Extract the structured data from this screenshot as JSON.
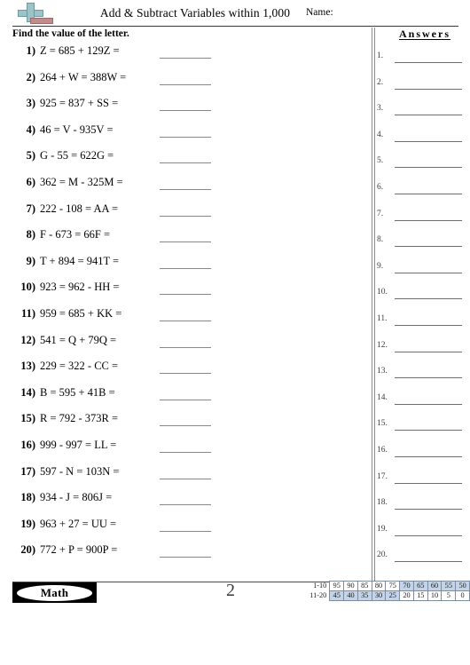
{
  "header": {
    "logo_name": "plus-minus-logo",
    "title": "Add & Subtract Variables within 1,000",
    "name_label": "Name:",
    "colors": {
      "plus": "#9cc3c8",
      "minus": "#c08b8b"
    }
  },
  "instruction": "Find the value of the letter.",
  "answers_heading": "Answers",
  "problems": [
    {
      "num": "1)",
      "text": "Z = 685 + 129Z ="
    },
    {
      "num": "2)",
      "text": "264 + W = 388W ="
    },
    {
      "num": "3)",
      "text": "925 = 837 + SS ="
    },
    {
      "num": "4)",
      "text": "46 = V - 935V ="
    },
    {
      "num": "5)",
      "text": "G - 55 = 622G ="
    },
    {
      "num": "6)",
      "text": "362 = M - 325M ="
    },
    {
      "num": "7)",
      "text": "222 - 108 = AA ="
    },
    {
      "num": "8)",
      "text": "F - 673 = 66F ="
    },
    {
      "num": "9)",
      "text": "T + 894 = 941T ="
    },
    {
      "num": "10)",
      "text": "923 = 962 - HH ="
    },
    {
      "num": "11)",
      "text": "959 = 685 + KK ="
    },
    {
      "num": "12)",
      "text": "541 = Q + 79Q ="
    },
    {
      "num": "13)",
      "text": "229 = 322 - CC ="
    },
    {
      "num": "14)",
      "text": "B = 595 + 41B ="
    },
    {
      "num": "15)",
      "text": "R = 792 - 373R ="
    },
    {
      "num": "16)",
      "text": "999 - 997 = LL ="
    },
    {
      "num": "17)",
      "text": "597 - N = 103N ="
    },
    {
      "num": "18)",
      "text": "934 - J = 806J ="
    },
    {
      "num": "19)",
      "text": "963 + 27 = UU ="
    },
    {
      "num": "20)",
      "text": "772 + P = 900P ="
    }
  ],
  "answer_numbers": [
    "1.",
    "2.",
    "3.",
    "4.",
    "5.",
    "6.",
    "7.",
    "8.",
    "9.",
    "10.",
    "11.",
    "12.",
    "13.",
    "14.",
    "15.",
    "16.",
    "17.",
    "18.",
    "19.",
    "20."
  ],
  "footer": {
    "badge_label": "Math",
    "page_number": "2"
  },
  "grading_scale": {
    "row1_label": "1-10",
    "row2_label": "11-20",
    "row1_values": [
      "95",
      "90",
      "85",
      "80",
      "75",
      "70",
      "65",
      "60",
      "55",
      "50"
    ],
    "row1_shaded": [
      false,
      false,
      false,
      false,
      false,
      true,
      true,
      true,
      true,
      true
    ],
    "row2_values": [
      "45",
      "40",
      "35",
      "30",
      "25",
      "20",
      "15",
      "10",
      "5",
      "0"
    ],
    "row2_shaded": [
      true,
      true,
      true,
      true,
      true,
      false,
      false,
      false,
      false,
      false
    ],
    "shade_color": "#c3d4e8"
  }
}
